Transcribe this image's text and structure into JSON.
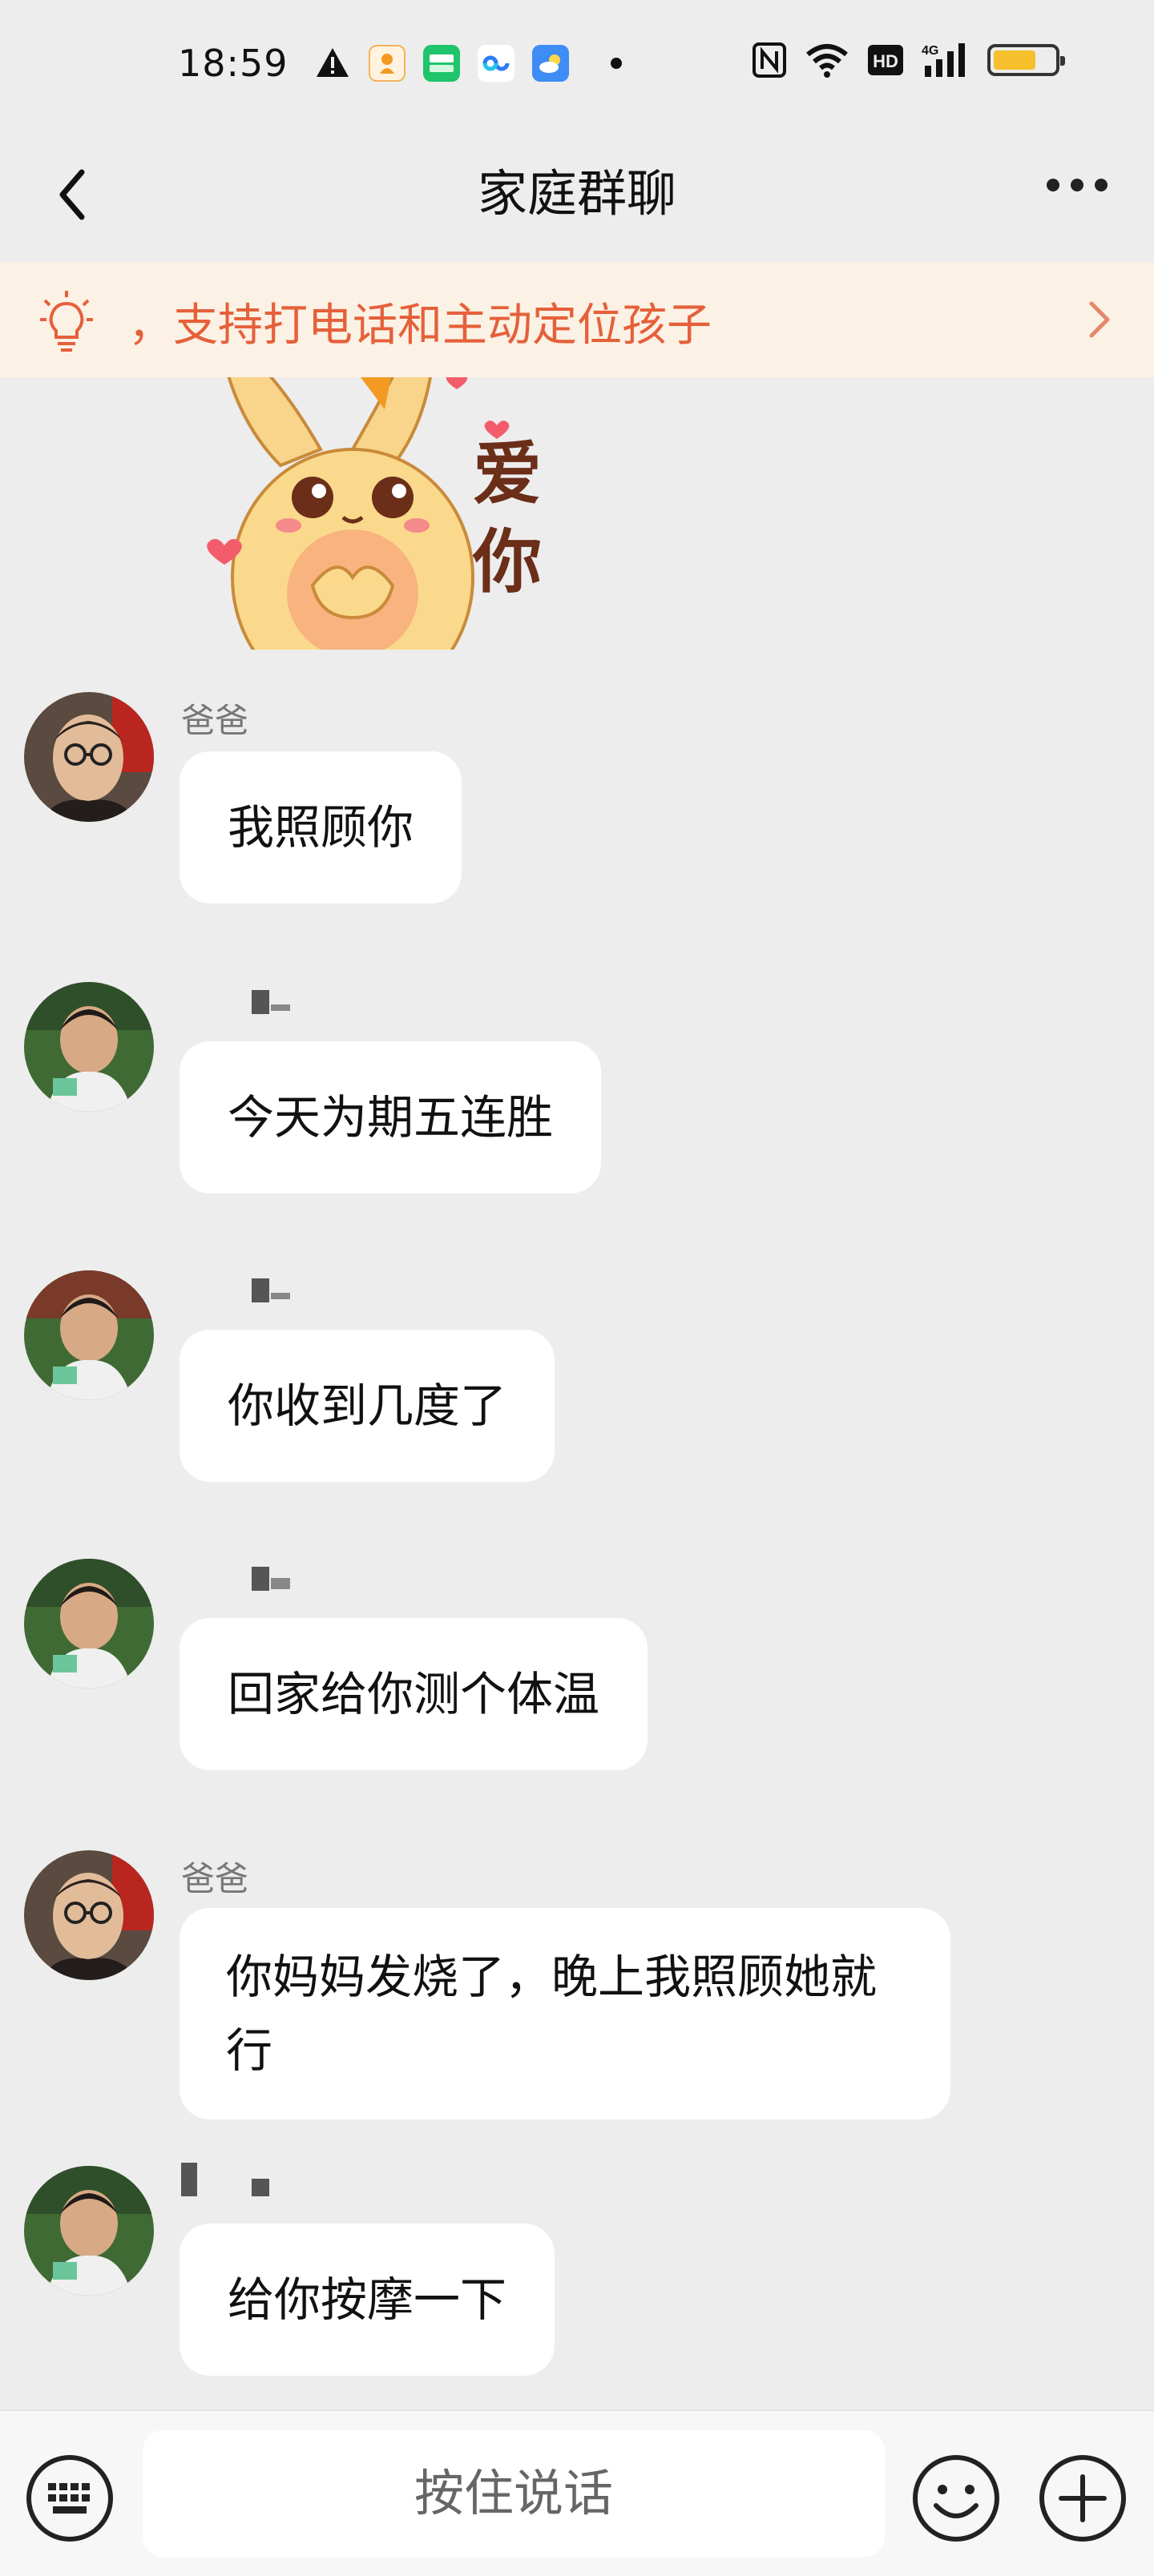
{
  "status_bar": {
    "time": "18:59",
    "left_icons": [
      "warning-icon",
      "kuaishou-app-icon",
      "iqiyi-app-icon",
      "cloud-link-app-icon",
      "weather-app-icon",
      "notification-dot"
    ],
    "right_icons": [
      "nfc-icon",
      "wifi-icon",
      "hd-icon",
      "signal-4g-icon",
      "battery-icon"
    ],
    "battery_level": 0.7,
    "battery_color": "#f5c02b"
  },
  "nav": {
    "title": "家庭群聊",
    "back_icon": "back-chevron-icon",
    "more_icon": "more-dots-icon"
  },
  "banner": {
    "text": "，支持打电话和主动定位孩子",
    "icon": "lightbulb-icon",
    "arrow_icon": "chevron-right-icon",
    "text_color": "#e5603a",
    "bg_color": "#fbf1e4"
  },
  "sticker": {
    "text1": "爱",
    "text2": "你"
  },
  "messages": [
    {
      "sender": "爸爸",
      "text": "我照顾你",
      "avatar": "dad"
    },
    {
      "sender": "",
      "text": "今天为期五连胜",
      "avatar": "child"
    },
    {
      "sender": "",
      "text": "你收到几度了",
      "avatar": "child"
    },
    {
      "sender": "",
      "text": "回家给你测个体温",
      "avatar": "child"
    },
    {
      "sender": "爸爸",
      "text": "你妈妈发烧了，晚上我照顾她就行",
      "avatar": "dad"
    },
    {
      "sender": "",
      "text": "给你按摩一下",
      "avatar": "child"
    }
  ],
  "input_bar": {
    "voice_label": "按住说话",
    "keyboard_icon": "keyboard-icon",
    "emoji_icon": "emoji-icon",
    "plus_icon": "plus-icon"
  },
  "colors": {
    "background": "#ededed",
    "bubble": "#ffffff"
  }
}
